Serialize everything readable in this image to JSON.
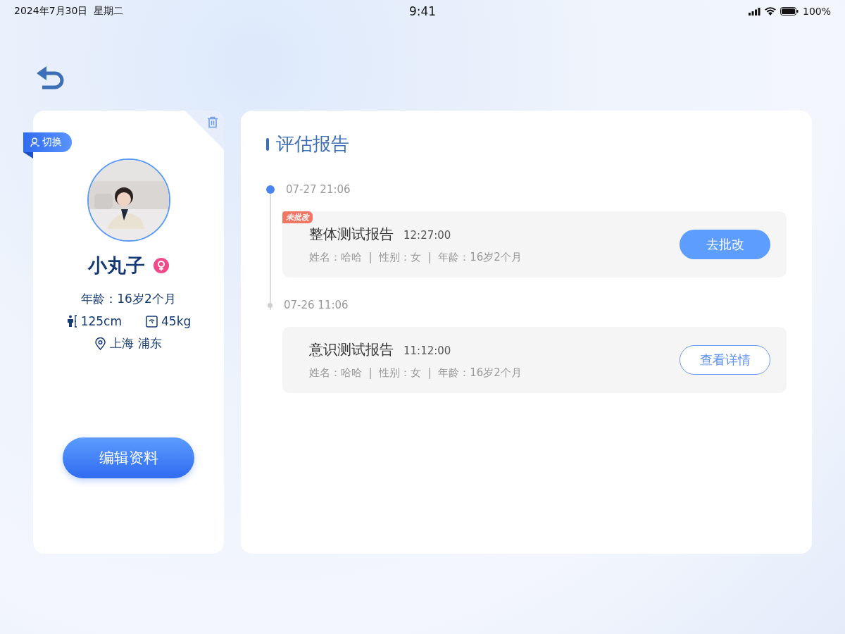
{
  "status_bar": {
    "date": "2024年7月30日  星期二",
    "time": "9:41",
    "battery": "100%"
  },
  "profile": {
    "switch_label": "切换",
    "name": "小丸子",
    "female": true,
    "age": "年龄：16岁2个月",
    "height": "125cm",
    "weight": "45kg",
    "location": "上海 浦东",
    "edit_button": "编辑资料"
  },
  "reports_panel": {
    "title": "评估报告",
    "entries": [
      {
        "date": "07-27 21:06",
        "active": true,
        "badge": "未批改",
        "title": "整体测试报告",
        "time": "12:27:00",
        "details": "姓名：哈哈  |  性别：女  |  年龄：16岁2个月",
        "action": {
          "label": "去批改",
          "kind": "primary"
        }
      },
      {
        "date": "07-26 11:06",
        "active": false,
        "title": "意识测试报告",
        "time": "11:12:00",
        "details": "姓名：哈哈  |  性别：女  |  年龄：16岁2个月",
        "action": {
          "label": "查看详情",
          "kind": "outline"
        }
      }
    ]
  }
}
